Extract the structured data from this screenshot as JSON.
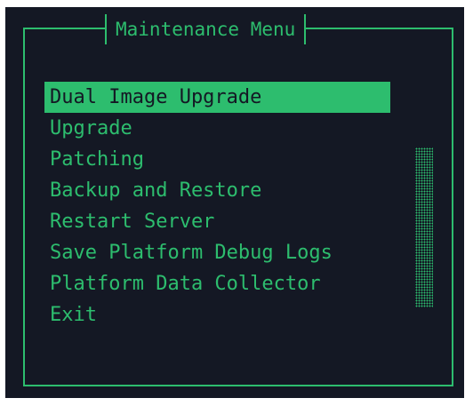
{
  "dialog": {
    "title": "Maintenance Menu",
    "items": [
      {
        "label": "Dual Image Upgrade",
        "selected": true
      },
      {
        "label": "Upgrade"
      },
      {
        "label": "Patching"
      },
      {
        "label": "Backup and Restore"
      },
      {
        "label": "Restart Server"
      },
      {
        "label": "Save Platform Debug Logs"
      },
      {
        "label": "Platform Data Collector"
      },
      {
        "label": "Exit"
      }
    ]
  },
  "colors": {
    "background": "#141824",
    "accent": "#2dbd6e"
  }
}
